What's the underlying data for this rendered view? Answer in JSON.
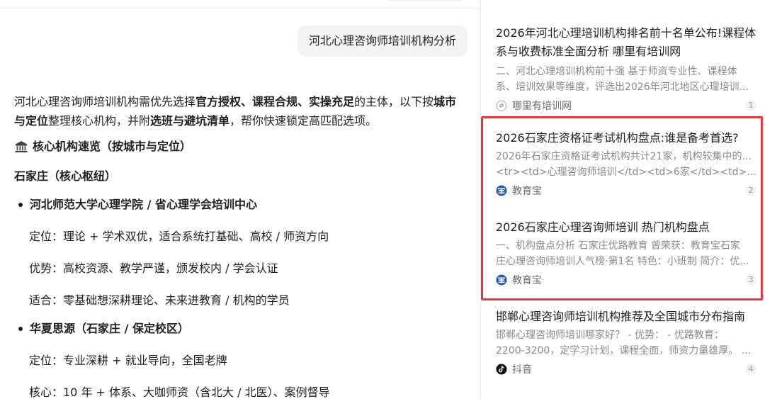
{
  "user_query": "河北心理咨询师培训机构分析",
  "answer": {
    "intro_parts": [
      {
        "text": "河北心理咨询师培训机构需优先选择",
        "bold": false
      },
      {
        "text": "官方授权、课程合规、实操充足",
        "bold": true
      },
      {
        "text": "的主体，以下按",
        "bold": false
      },
      {
        "text": "城市与定位",
        "bold": true
      },
      {
        "text": "整理核心机构，并附",
        "bold": false
      },
      {
        "text": "选班与避坑清单",
        "bold": true
      },
      {
        "text": "，帮你快速锁定高匹配选项。",
        "bold": false
      }
    ],
    "section_icon": "classical-building-icon",
    "section_heading": "核心机构速览（按城市与定位）",
    "city_heading": "石家庄（核心枢纽）",
    "institutions": [
      {
        "name": "河北师范大学心理学院 / 省心理学会培训中心",
        "details": [
          "定位：理论 + 学术双优，适合系统打基础、高校 / 师资方向",
          "优势：高校资源、教学严谨，颁发校内 / 学会认证",
          "适合：零基础想深耕理论、未来进教育 / 机构的学员"
        ]
      },
      {
        "name": "华夏思源（石家庄 / 保定校区）",
        "details": [
          "定位：专业深耕 + 就业导向，全国老牌",
          "核心：10 年 + 体系、大咖师资（含北大 / 北医）、案例督导"
        ]
      }
    ]
  },
  "results": [
    {
      "title": "2026年河北心理培训机构排名前十名单公布!课程体系与收费标准全面分析 哪里有培训网",
      "snippet_lines": [
        "二、河北心理培训机构前十强 基于师资专业性、课程体",
        "系、培训效果等维度，评选出2026年河北地区心理培训..."
      ],
      "source": "哪里有培训网",
      "source_icon": "link-icon",
      "index": "1"
    },
    {
      "title": "2026石家庄资格证考试机构盘点:谁是备考首选?",
      "snippet_lines": [
        "2026年石家庄资格证考试机构共计21家，机构较集中的...",
        "<tr><td>心理咨询师培训</td><td>6家</td><td>..."
      ],
      "source": "教育宝",
      "source_icon": "jiaoyubao-icon",
      "index": "2"
    },
    {
      "title": "2026石家庄心理咨询师培训 热门机构盘点",
      "snippet_lines": [
        "一、机构盘点分析 石家庄优路教育 曾荣获：教育宝石家",
        "庄心理咨询师培训人气榜·第1名 特色：小班制 简介：优..."
      ],
      "source": "教育宝",
      "source_icon": "jiaoyubao-icon",
      "index": "3"
    },
    {
      "title": "邯郸心理咨询师培训机构推荐及全国城市分布指南",
      "snippet_lines": [
        "邯郸心理咨询师培训哪家好？ - 优势： - 优路教育：",
        "2200-3200，定学习计划，课程全面，师资力量雄厚。 ..."
      ],
      "source": "抖音",
      "source_icon": "douyin-icon",
      "index": "4"
    }
  ],
  "colors": {
    "highlight_border": "#e5393b",
    "snippet_text": "#8a8a8a",
    "bubble_bg": "#f2f3f5",
    "jiaoyubao_blue": "#1f5fb4"
  }
}
